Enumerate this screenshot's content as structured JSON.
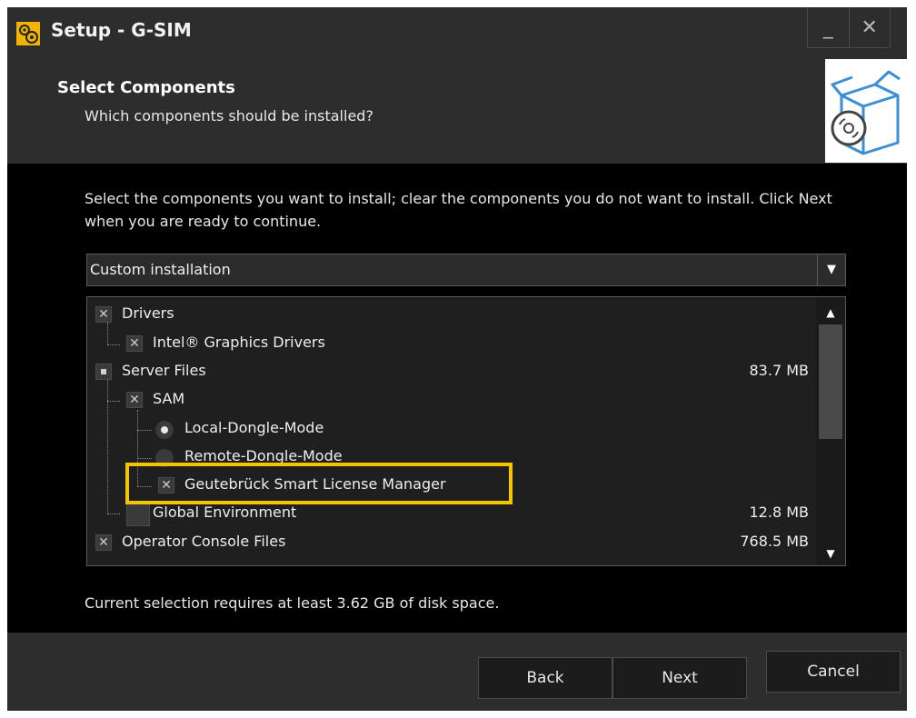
{
  "window": {
    "title": "Setup - G-SIM",
    "minimize": "_",
    "close": "✕"
  },
  "header": {
    "title": "Select Components",
    "subtitle": "Which components should be installed?"
  },
  "content": {
    "description": "Select the components you want to install; clear the components you do not want to install. Click Next when you are ready to continue.",
    "install_type": "Custom installation",
    "disk_requirement": "Current selection requires at least 3.62 GB of disk space."
  },
  "components": [
    {
      "label": "Drivers",
      "state": "checked",
      "size": ""
    },
    {
      "label": "Intel® Graphics Drivers",
      "state": "checked",
      "size": ""
    },
    {
      "label": "Server Files",
      "state": "partial",
      "size": "83.7 MB"
    },
    {
      "label": "SAM",
      "state": "checked",
      "size": ""
    },
    {
      "label": "Local-Dongle-Mode",
      "state": "radio-on",
      "size": ""
    },
    {
      "label": "Remote-Dongle-Mode",
      "state": "radio-off",
      "size": ""
    },
    {
      "label": "Geutebrück Smart License Manager",
      "state": "checked",
      "size": ""
    },
    {
      "label": "Global Environment",
      "state": "unchecked",
      "size": "12.8 MB"
    },
    {
      "label": "Operator Console Files",
      "state": "checked",
      "size": "768.5 MB"
    }
  ],
  "buttons": {
    "back": "Back",
    "next": "Next",
    "cancel": "Cancel"
  },
  "colors": {
    "highlight": "#f2c500",
    "window_bg": "#2d2d2d",
    "content_bg": "#000000"
  }
}
